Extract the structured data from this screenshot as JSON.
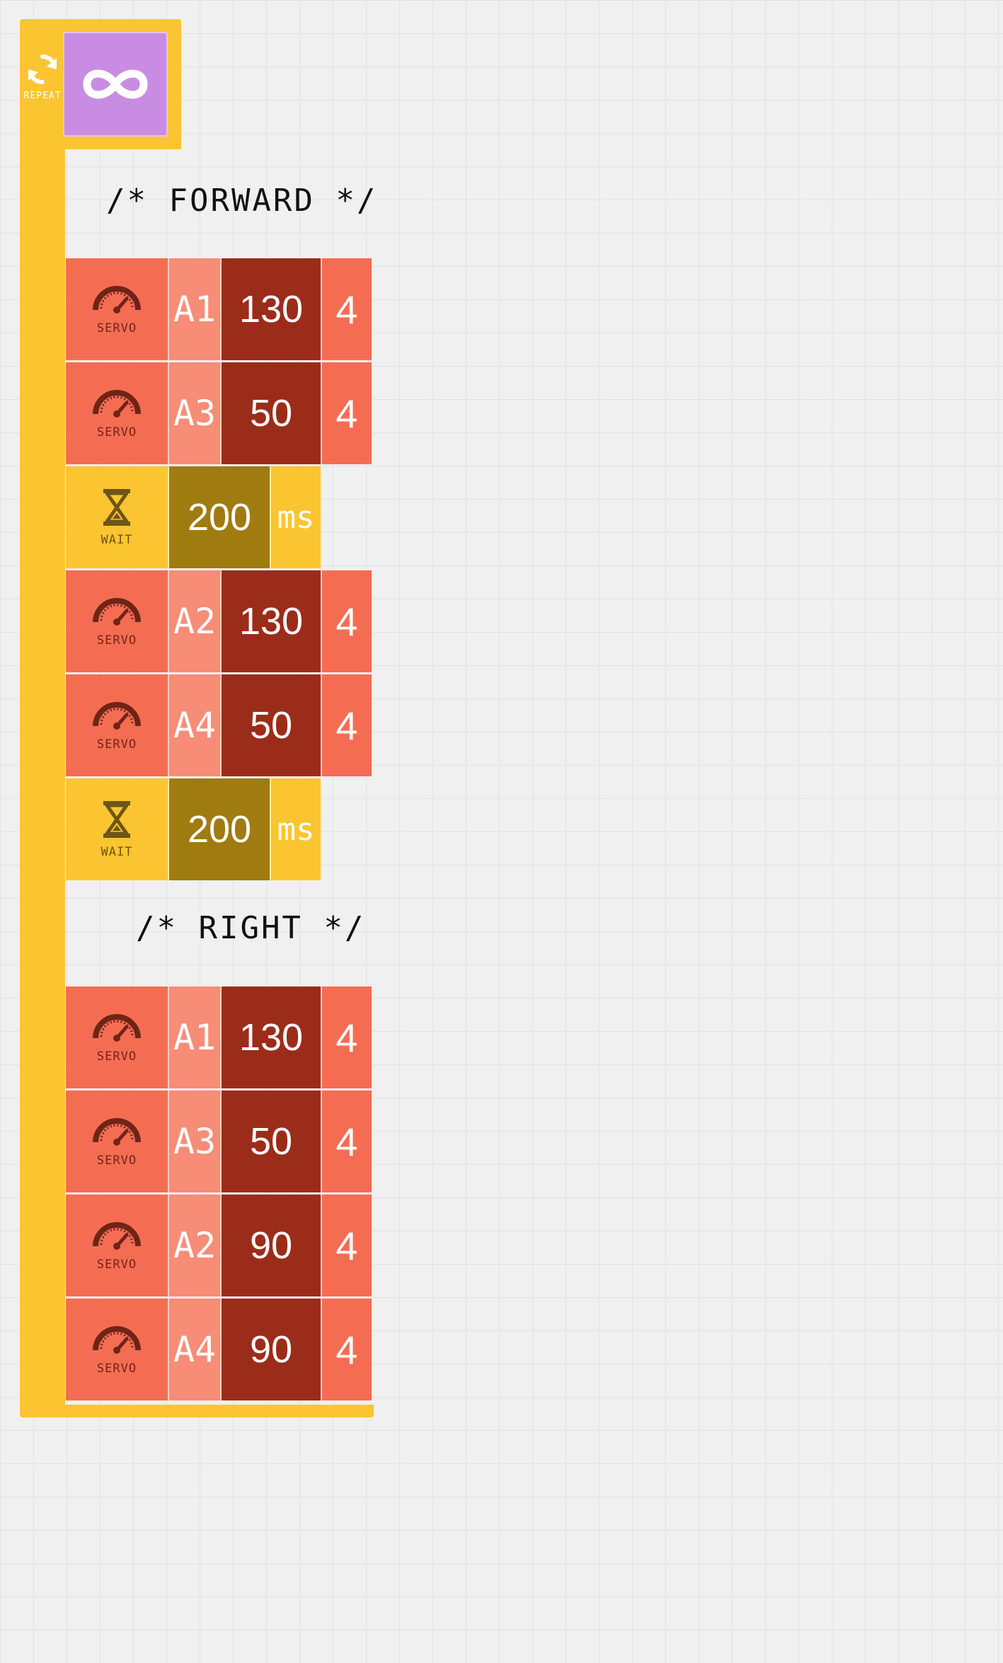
{
  "repeat": {
    "label": "REPEAT",
    "mode_icon": "infinity-icon"
  },
  "comments": {
    "forward": "/* FORWARD */",
    "right": "/* RIGHT */"
  },
  "blocks": [
    {
      "type": "servo",
      "label": "SERVO",
      "port": "A1",
      "angle": "130",
      "speed": "4"
    },
    {
      "type": "servo",
      "label": "SERVO",
      "port": "A3",
      "angle": "50",
      "speed": "4"
    },
    {
      "type": "wait",
      "label": "WAIT",
      "duration": "200",
      "unit": "ms"
    },
    {
      "type": "servo",
      "label": "SERVO",
      "port": "A2",
      "angle": "130",
      "speed": "4"
    },
    {
      "type": "servo",
      "label": "SERVO",
      "port": "A4",
      "angle": "50",
      "speed": "4"
    },
    {
      "type": "wait",
      "label": "WAIT",
      "duration": "200",
      "unit": "ms"
    },
    {
      "type": "servo",
      "label": "SERVO",
      "port": "A1",
      "angle": "130",
      "speed": "4"
    },
    {
      "type": "servo",
      "label": "SERVO",
      "port": "A3",
      "angle": "50",
      "speed": "4"
    },
    {
      "type": "servo",
      "label": "SERVO",
      "port": "A2",
      "angle": "90",
      "speed": "4"
    },
    {
      "type": "servo",
      "label": "SERVO",
      "port": "A4",
      "angle": "90",
      "speed": "4"
    }
  ],
  "colors": {
    "repeat": "#fbc531",
    "forever": "#c98ce3",
    "servo": "#f46d53",
    "servo_port": "#f78c77",
    "servo_angle": "#9c2c1a",
    "wait_value": "#a07b10"
  }
}
